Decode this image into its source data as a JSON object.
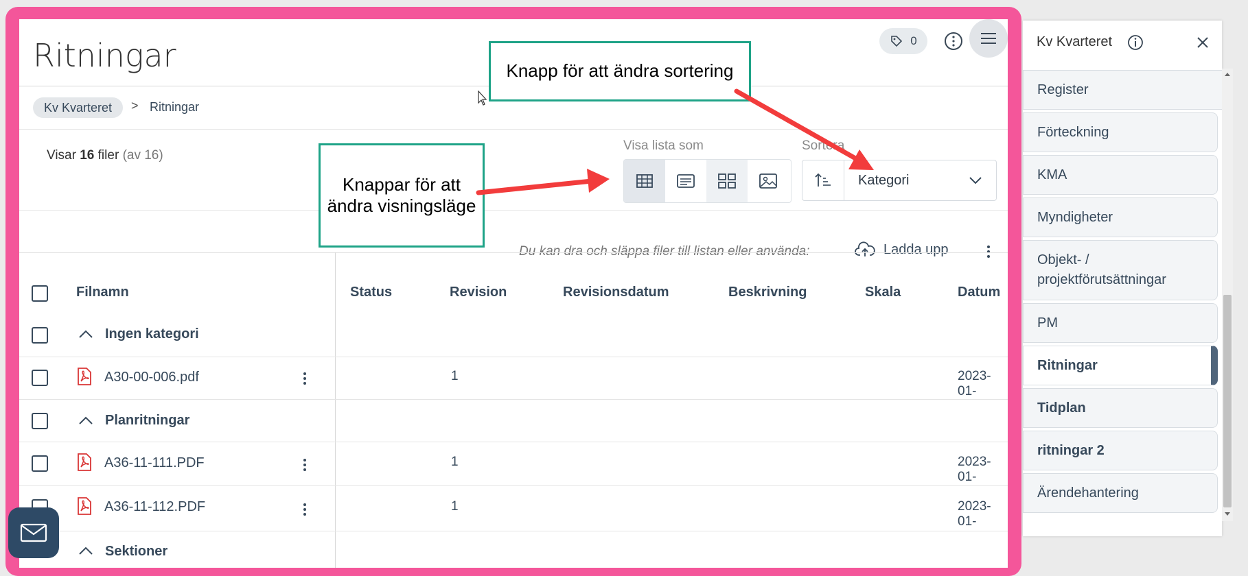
{
  "page": {
    "title": "Ritningar"
  },
  "toolbar": {
    "tag_count": "0"
  },
  "breadcrumb": {
    "root": "Kv Kvarteret",
    "separator": ">",
    "current": "Ritningar"
  },
  "listing": {
    "prefix": "Visar",
    "count": "16",
    "unit": "filer",
    "total": "(av 16)"
  },
  "view_mode": {
    "label": "Visa lista som",
    "options": [
      "table-icon",
      "list-icon",
      "grid-icon",
      "image-icon"
    ],
    "active": "table-icon"
  },
  "sort": {
    "label": "Sortera",
    "value": "Kategori"
  },
  "upload": {
    "hint": "Du kan dra och släppa filer till listan eller använda:",
    "label": "Ladda upp"
  },
  "table": {
    "columns": [
      "Filnamn",
      "Status",
      "Revision",
      "Revisionsdatum",
      "Beskrivning",
      "Skala",
      "Datum"
    ],
    "groups": [
      {
        "name": "Ingen kategori",
        "files": [
          {
            "name": "A30-00-006.pdf",
            "revision": "1",
            "date": "2023-01-"
          }
        ]
      },
      {
        "name": "Planritningar",
        "files": [
          {
            "name": "A36-11-111.PDF",
            "revision": "1",
            "date": "2023-01-"
          },
          {
            "name": "A36-11-112.PDF",
            "revision": "1",
            "date": "2023-01-"
          }
        ]
      },
      {
        "name": "Sektioner",
        "files": []
      }
    ]
  },
  "callouts": {
    "sorting": "Knapp för att ändra sortering",
    "view_modes": "Knappar för att ändra visningsläge"
  },
  "sidebar": {
    "title": "Kv Kvarteret",
    "items": [
      {
        "label": "Register"
      },
      {
        "label": "Förteckning"
      },
      {
        "label": "KMA"
      },
      {
        "label": "Myndigheter"
      },
      {
        "label": "Objekt- / projektförutsättningar"
      },
      {
        "label": "PM"
      },
      {
        "label": "Ritningar"
      },
      {
        "label": "Tidplan"
      },
      {
        "label": "ritningar 2"
      },
      {
        "label": "Ärendehantering"
      }
    ]
  },
  "colors": {
    "frame": "#f4569a",
    "text": "#37495b",
    "callout_border": "#1ea387",
    "arrow": "#f23c3c",
    "pdf": "#d93535"
  }
}
